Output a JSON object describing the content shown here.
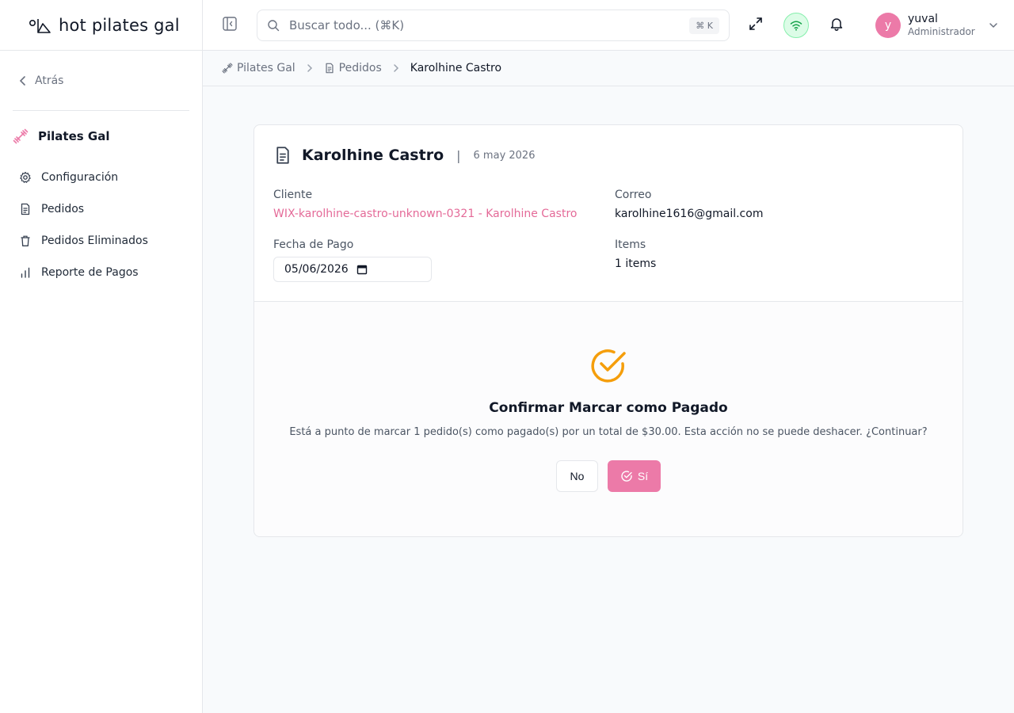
{
  "app": {
    "logo_text": "hot pilates gal"
  },
  "sidebar": {
    "back_label": "Atrás",
    "section_title": "Pilates Gal",
    "items": [
      {
        "label": "Configuración",
        "icon": "gear-icon"
      },
      {
        "label": "Pedidos",
        "icon": "document-icon"
      },
      {
        "label": "Pedidos Eliminados",
        "icon": "trash-icon"
      },
      {
        "label": "Reporte de Pagos",
        "icon": "bar-chart-icon"
      }
    ]
  },
  "topbar": {
    "search_placeholder": "Buscar todo... (⌘K)",
    "search_shortcut": "⌘ K",
    "user": {
      "initial": "y",
      "name": "yuval",
      "role": "Administrador"
    },
    "status_color": "#22c55e"
  },
  "breadcrumb": {
    "items": [
      "Pilates Gal",
      "Pedidos",
      "Karolhine Castro"
    ]
  },
  "order": {
    "title": "Karolhine Castro",
    "date": "6 may 2026",
    "client_label": "Cliente",
    "client_value": "WIX-karolhine-castro-unknown-0321 - Karolhine Castro",
    "email_label": "Correo",
    "email_value": "karolhine1616@gmail.com",
    "payment_date_label": "Fecha de Pago",
    "payment_date_value": "05/06/2026",
    "items_label": "Items",
    "items_value": "1 items"
  },
  "confirm": {
    "title": "Confirmar Marcar como Pagado",
    "message": "Está a punto de marcar 1 pedido(s) como pagado(s) por un total de $30.00. Esta acción no se puede deshacer. ¿Continuar?",
    "no_label": "No",
    "yes_label": "Sí"
  },
  "colors": {
    "accent": "#ec7aa8",
    "link": "#e46a98",
    "warning": "#f59e0b"
  }
}
